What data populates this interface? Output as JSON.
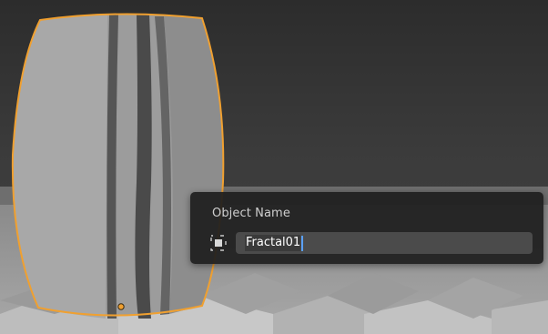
{
  "popup": {
    "title": "Object Name",
    "field_value": "Fractal01"
  },
  "icons": {
    "object": "object-data-icon",
    "origin": "object-origin-icon"
  },
  "colors": {
    "selection_outline": "#f0a030",
    "text_cursor": "#5aa0ff",
    "popup_background": "#1e1e1e",
    "field_background": "#4b4b4b"
  }
}
